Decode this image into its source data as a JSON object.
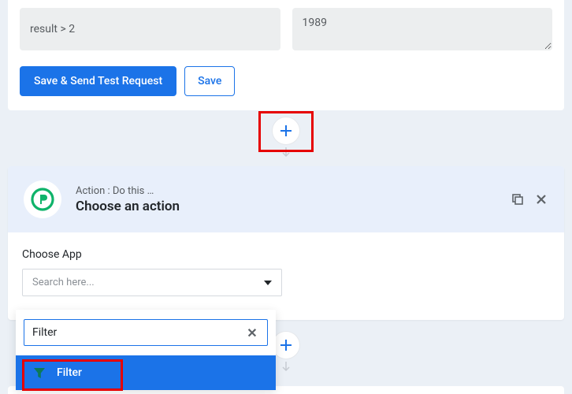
{
  "top": {
    "input1_value": "result > 2",
    "input2_value": "1989",
    "save_send_label": "Save & Send Test Request",
    "save_label": "Save"
  },
  "action": {
    "subtitle": "Action : Do this …",
    "title": "Choose an action",
    "choose_app_label": "Choose App",
    "select_placeholder": "Search here...",
    "search_value": "Filter",
    "result_label": "Filter"
  }
}
